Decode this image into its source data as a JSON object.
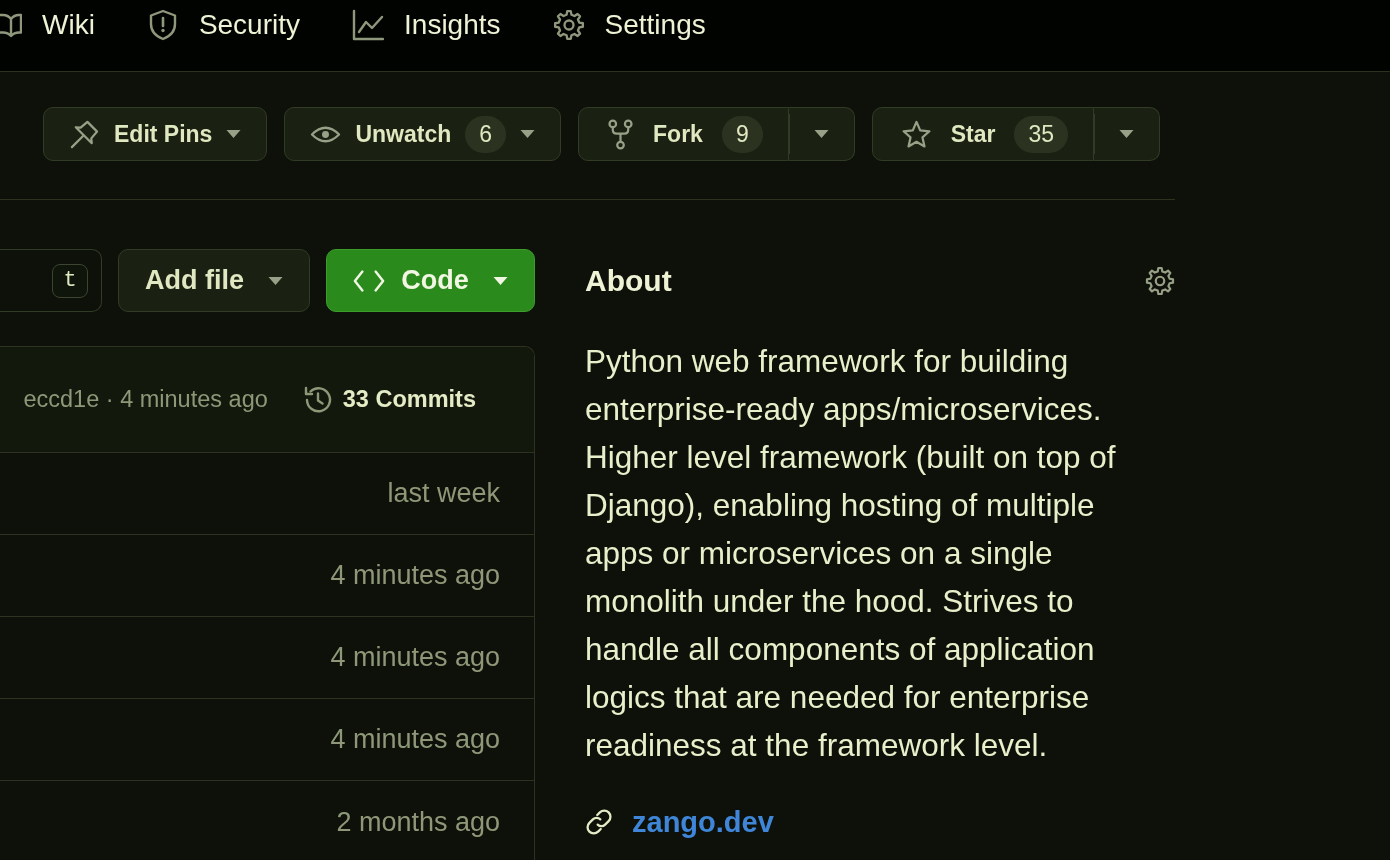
{
  "repo_nav": {
    "items": [
      {
        "label": "Wiki",
        "selected": false
      },
      {
        "label": "Security",
        "selected": false
      },
      {
        "label": "Insights",
        "selected": false
      },
      {
        "label": "Settings",
        "selected": false
      }
    ]
  },
  "repo_actions": [
    {
      "kind": "menu",
      "label": "Edit Pins"
    },
    {
      "kind": "menu",
      "label": "Unwatch",
      "count": "6"
    },
    {
      "kind": "split",
      "label": "Fork",
      "count": "9"
    },
    {
      "kind": "split",
      "label": "Star",
      "count": "35"
    }
  ],
  "file_toolbar": {
    "go_to_file": {
      "shortcut": "t"
    },
    "add_file": {
      "label": "Add file"
    },
    "code": {
      "label": "Code"
    }
  },
  "latest_commit": {
    "summary": "eccd1e · 4 minutes ago",
    "commits": "33 Commits"
  },
  "files": {
    "rows": [
      {
        "time": "last week"
      },
      {
        "time": "4 minutes ago"
      },
      {
        "time": "4 minutes ago"
      },
      {
        "time": "4 minutes ago"
      },
      {
        "time": "2 months ago"
      }
    ]
  },
  "about": {
    "title": "About",
    "description": "Python web framework for building enterprise-ready apps/microservices. Higher level framework (built on top of Django), enabling hosting of multiple apps or microservices on a single monolith under the hood. Strives to handle all components of application logics that are needed for enterprise readiness at the framework level.",
    "link": "zango.dev"
  }
}
